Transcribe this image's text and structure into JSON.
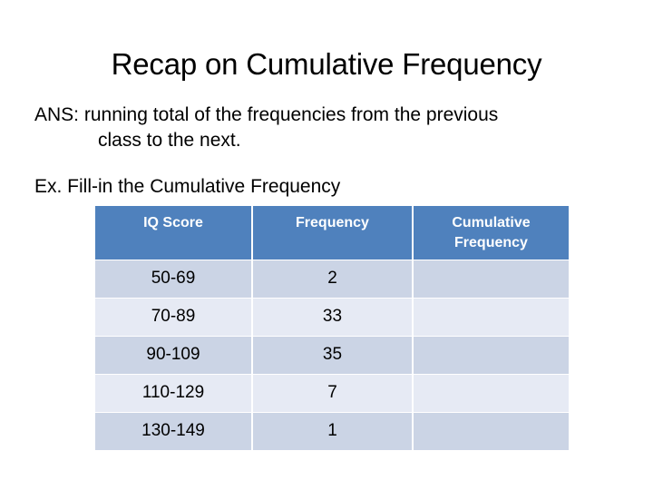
{
  "slide": {
    "title": "Recap on Cumulative Frequency",
    "answer": {
      "line1": "ANS: running total of the frequencies from the previous",
      "line2": "class to the next."
    },
    "example_prompt": "Ex. Fill-in the Cumulative Frequency"
  },
  "table": {
    "headers": [
      {
        "label": "IQ Score"
      },
      {
        "label": "Frequency"
      },
      {
        "label_line1": "Cumulative",
        "label_line2": "Frequency"
      }
    ],
    "rows": [
      {
        "iq_score": "50-69",
        "frequency": "2",
        "cumulative_frequency": ""
      },
      {
        "iq_score": "70-89",
        "frequency": "33",
        "cumulative_frequency": ""
      },
      {
        "iq_score": "90-109",
        "frequency": "35",
        "cumulative_frequency": ""
      },
      {
        "iq_score": "110-129",
        "frequency": "7",
        "cumulative_frequency": ""
      },
      {
        "iq_score": "130-149",
        "frequency": "1",
        "cumulative_frequency": ""
      }
    ]
  },
  "colors": {
    "header_blue": "#4F81BD",
    "row_dark": "#CBD4E5",
    "row_light": "#E6EAF4",
    "text": "#000000",
    "header_text": "#FFFFFF"
  }
}
